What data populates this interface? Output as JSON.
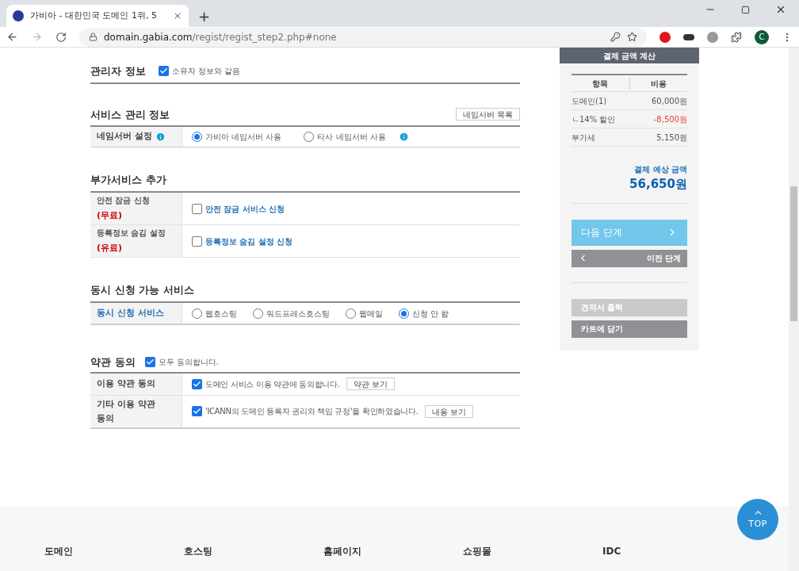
{
  "browser": {
    "tab_title": "가비아 - 대한민국 도메인 1위, 5",
    "new_tab": "+",
    "url_host": "domain.gabia.com",
    "url_path": "/regist/regist_step2.php#none",
    "profile": "C"
  },
  "admin": {
    "title": "관리자 정보",
    "same_as_owner": {
      "label": "소유자 정보와 같음",
      "checked": true
    }
  },
  "service": {
    "title": "서비스 관리 정보",
    "list_button": "네임서버 목록",
    "row_label": "네임서버 설정",
    "options": [
      {
        "label": "가비아 네임서버 사용",
        "selected": true,
        "info": false
      },
      {
        "label": "타사 네임서버 사용",
        "selected": false,
        "info": true
      }
    ]
  },
  "addons": {
    "title": "부가서비스 추가",
    "rows": [
      {
        "label": "안전 잠금 신청",
        "price": "(무료)",
        "option": "안전 잠금 서비스 신청",
        "checked": false
      },
      {
        "label": "등록정보 숨김 설정",
        "price": "(유료)",
        "option": "등록정보 숨김 설정 신청",
        "checked": false
      }
    ]
  },
  "concurrent": {
    "title": "동시 신청 가능 서비스",
    "row_label": "동시 신청 서비스",
    "options": [
      {
        "label": "웹호스팅",
        "selected": false
      },
      {
        "label": "워드프레스호스팅",
        "selected": false
      },
      {
        "label": "웹메일",
        "selected": false
      },
      {
        "label": "신청 안 함",
        "selected": true
      }
    ]
  },
  "terms": {
    "title": "약관 동의",
    "agree_all": {
      "label": "모두 동의합니다.",
      "checked": true
    },
    "rows": [
      {
        "label": "이용 약관 동의",
        "text": "도메인 서비스 이용 약관에 동의합니다.",
        "button": "약관 보기",
        "checked": true
      },
      {
        "label": "기타 이용 약관 동의",
        "text": "'ICANN의 도메인 등록자 권리와 책임 규정'을 확인하였습니다.",
        "button": "내용 보기",
        "checked": true
      }
    ]
  },
  "summary": {
    "title": "결제 금액 계산",
    "columns": [
      "항목",
      "비용"
    ],
    "rows": [
      {
        "item": "도메인(1)",
        "cost": "60,000원",
        "negative": false
      },
      {
        "item": "ㄴ14% 할인",
        "cost": "-8,500원",
        "negative": true
      },
      {
        "item": "부가세",
        "cost": "5,150원",
        "negative": false
      }
    ],
    "total_label": "결제 예상 금액",
    "total": "56,650원",
    "next": "다음 단계",
    "prev": "이전 단계",
    "estimate": "견적서 출력",
    "cart": "카트에 담기"
  },
  "top_button": "TOP",
  "footer": [
    "도메인",
    "호스팅",
    "홈페이지",
    "쇼핑몰",
    "IDC"
  ]
}
